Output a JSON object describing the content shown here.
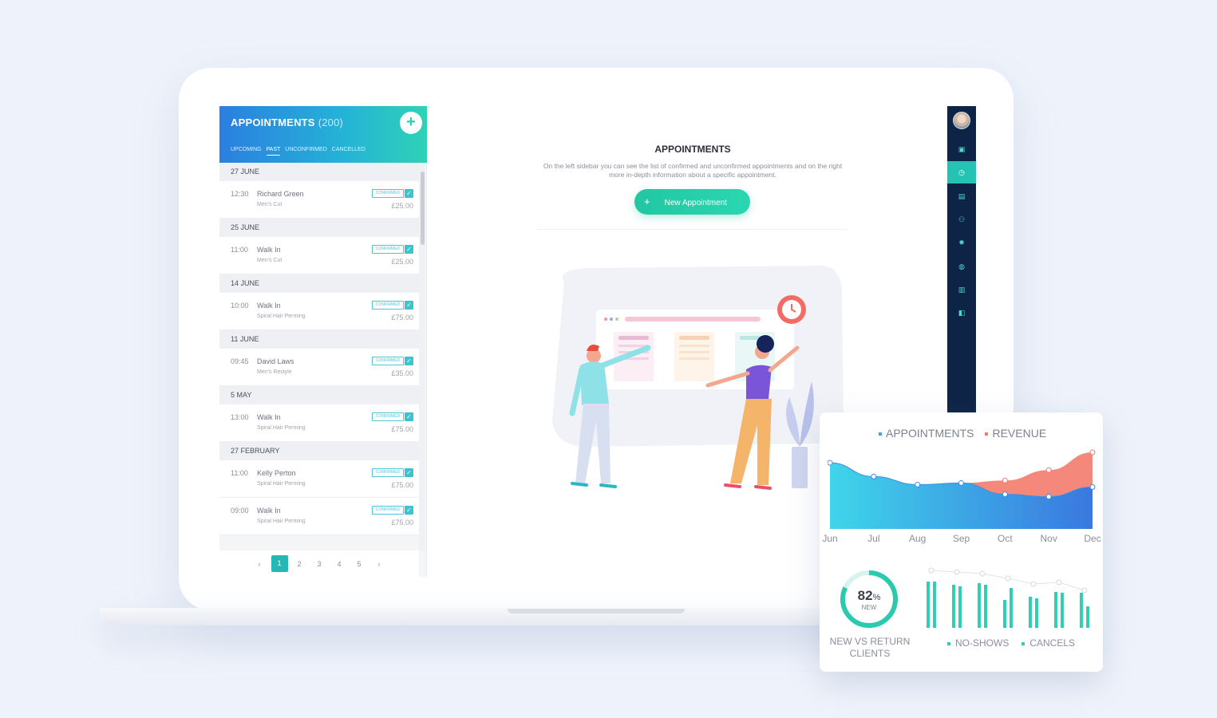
{
  "sidebar": {
    "title": "APPOINTMENTS",
    "count": "(200)",
    "add_label": "+",
    "tabs": [
      "UPCOMING",
      "PAST",
      "UNCONFIRMED",
      "CANCELLED"
    ],
    "active_tab": "PAST",
    "groups": [
      {
        "date": "27 JUNE",
        "items": [
          {
            "time": "12:30",
            "name": "Richard Green",
            "service": "Men's Cut",
            "status": "CONFIRMED",
            "price": "£25.00"
          }
        ]
      },
      {
        "date": "25 JUNE",
        "items": [
          {
            "time": "11:00",
            "name": "Walk In",
            "service": "Men's Cut",
            "status": "CONFIRMED",
            "price": "£25.00"
          }
        ]
      },
      {
        "date": "14 JUNE",
        "items": [
          {
            "time": "10:00",
            "name": "Walk In",
            "service": "Spiral Hair Perming",
            "status": "CONFIRMED",
            "price": "£75.00"
          }
        ]
      },
      {
        "date": "11 JUNE",
        "items": [
          {
            "time": "09:45",
            "name": "David Laws",
            "service": "Men's Restyle",
            "status": "CONFIRMED",
            "price": "£35.00"
          }
        ]
      },
      {
        "date": "5 MAY",
        "items": [
          {
            "time": "13:00",
            "name": "Walk In",
            "service": "Spiral Hair Perming",
            "status": "CONFIRMED",
            "price": "£75.00"
          }
        ]
      },
      {
        "date": "27 FEBRUARY",
        "items": [
          {
            "time": "11:00",
            "name": "Kelly Perton",
            "service": "Spiral Hair Perming",
            "status": "CONFIRMED",
            "price": "£75.00"
          },
          {
            "time": "09:00",
            "name": "Walk In",
            "service": "Spiral Hair Perming",
            "status": "CONFIRMED",
            "price": "£75.00"
          }
        ]
      }
    ],
    "pagination": {
      "prev": "‹",
      "pages": [
        "1",
        "2",
        "3",
        "4",
        "5"
      ],
      "active": "1",
      "next": "›"
    }
  },
  "main": {
    "title": "APPOINTMENTS",
    "description": "On the left sidebar you can see the list of confirmed and unconfirmed appointments and on the right more in-depth information about a specific appointment.",
    "new_button_icon": "+",
    "new_button_label": "New Appointment"
  },
  "nav_icons": [
    "calendar-icon",
    "clock-icon",
    "list-icon",
    "users-icon",
    "gear-icon",
    "globe-icon",
    "chart-icon",
    "wallet-icon"
  ],
  "nav_active": "clock-icon",
  "colors": {
    "accent": "#25c3b3",
    "nav_bg": "#0e2447",
    "appointments": "#3aa6e8",
    "revenue": "#f37b6b"
  },
  "analytics": {
    "legend": [
      {
        "name": "APPOINTMENTS",
        "color": "#3aa6e8"
      },
      {
        "name": "REVENUE",
        "color": "#f37b6b"
      }
    ],
    "donut": {
      "value": 82,
      "value_text": "82",
      "unit": "%",
      "sub": "NEW",
      "label": "NEW VS RETURN CLIENTS"
    },
    "bar_legend": [
      "NO-SHOWS",
      "CANCELS"
    ]
  },
  "chart_data": [
    {
      "type": "area",
      "categories": [
        "Jun",
        "Jul",
        "Aug",
        "Sep",
        "Oct",
        "Nov",
        "Dec"
      ],
      "series": [
        {
          "name": "APPOINTMENTS",
          "values": [
            82,
            65,
            55,
            57,
            43,
            40,
            52
          ]
        },
        {
          "name": "REVENUE",
          "values": [
            null,
            null,
            null,
            57,
            60,
            73,
            95
          ]
        }
      ],
      "ylim": [
        0,
        100
      ]
    },
    {
      "type": "bar",
      "series": [
        {
          "name": "NO-SHOWS",
          "values": [
            58,
            54,
            56,
            35,
            39,
            45,
            44
          ]
        },
        {
          "name": "CANCELS",
          "values": [
            58,
            52,
            54,
            50,
            37,
            44,
            27
          ]
        }
      ],
      "line": [
        72,
        70,
        68,
        62,
        55,
        57,
        47
      ],
      "ylim": [
        0,
        80
      ]
    }
  ]
}
